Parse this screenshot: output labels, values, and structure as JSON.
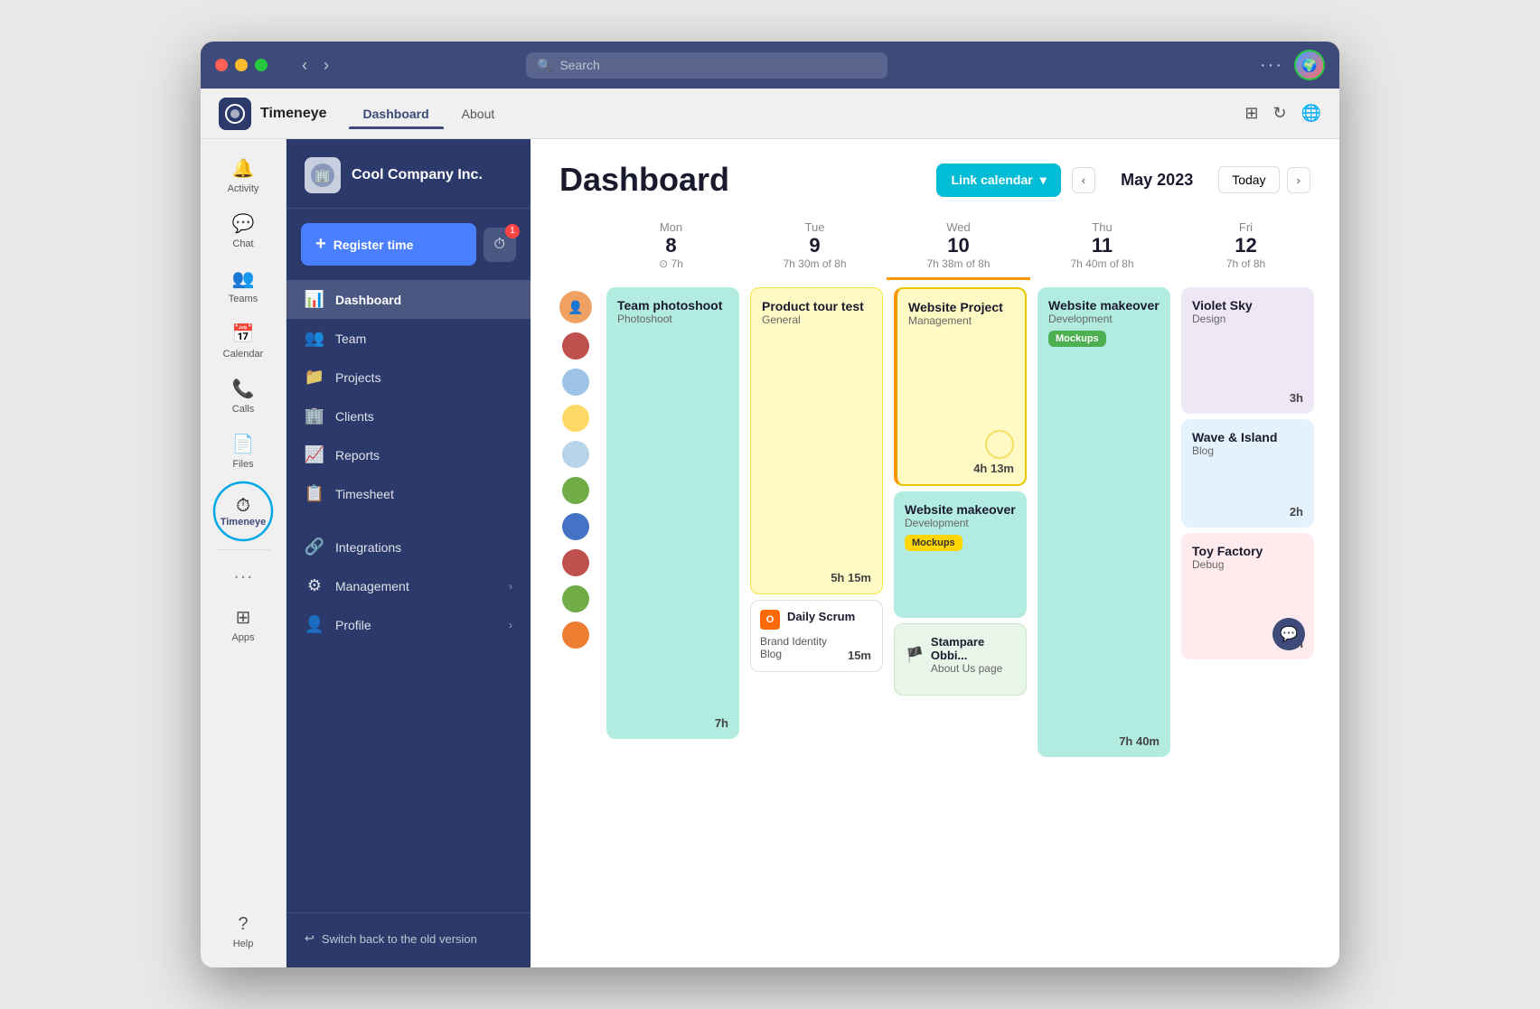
{
  "window": {
    "title": "Timeneye"
  },
  "titlebar": {
    "search_placeholder": "Search",
    "dots": "···"
  },
  "appbar": {
    "app_name": "Timeneye",
    "tabs": [
      {
        "label": "Dashboard",
        "active": true
      },
      {
        "label": "About",
        "active": false
      }
    ]
  },
  "teams_sidebar": {
    "items": [
      {
        "label": "Activity",
        "icon": "🔔"
      },
      {
        "label": "Chat",
        "icon": "💬"
      },
      {
        "label": "Teams",
        "icon": "👥"
      },
      {
        "label": "Calendar",
        "icon": "📅"
      },
      {
        "label": "Calls",
        "icon": "📞"
      },
      {
        "label": "Files",
        "icon": "📄"
      },
      {
        "label": "Timeneye",
        "icon": "⏱",
        "active": true,
        "circled": true
      },
      {
        "label": "Apps",
        "icon": "⊞"
      },
      {
        "label": "Help",
        "icon": "?"
      }
    ]
  },
  "sidebar": {
    "company": "Cool Company Inc.",
    "register_btn": "Register time",
    "timer_badge": "1",
    "nav_items": [
      {
        "label": "Dashboard",
        "icon": "📊",
        "active": true
      },
      {
        "label": "Team",
        "icon": "👥",
        "active": false
      },
      {
        "label": "Projects",
        "icon": "📁",
        "active": false
      },
      {
        "label": "Clients",
        "icon": "🏢",
        "active": false
      },
      {
        "label": "Reports",
        "icon": "📈",
        "active": false
      },
      {
        "label": "Timesheet",
        "icon": "📋",
        "active": false
      },
      {
        "label": "Integrations",
        "icon": "🔗",
        "active": false
      },
      {
        "label": "Management",
        "icon": "⚙",
        "active": false,
        "arrow": true
      },
      {
        "label": "Profile",
        "icon": "👤",
        "active": false,
        "arrow": true
      }
    ],
    "switch_version": "Switch back to the old version"
  },
  "content": {
    "title": "Dashboard",
    "link_calendar_btn": "Link calendar",
    "month": "May 2023",
    "today_btn": "Today",
    "days": [
      {
        "name": "Mon",
        "num": "8",
        "sub": "⊙ 7h"
      },
      {
        "name": "Tue",
        "num": "9",
        "sub": "7h 30m of 8h"
      },
      {
        "name": "Wed",
        "num": "10",
        "sub": "7h 38m of 8h",
        "today": true
      },
      {
        "name": "Thu",
        "num": "11",
        "sub": "7h 40m of 8h"
      },
      {
        "name": "Fri",
        "num": "12",
        "sub": "7h of 8h"
      }
    ],
    "events": {
      "mon": [
        {
          "title": "Team photoshoot",
          "sub": "Photoshoot",
          "color": "teal",
          "time": "7h"
        }
      ],
      "tue": [
        {
          "title": "Product tour test",
          "sub": "General",
          "color": "yellow",
          "time": "5h 15m"
        },
        {
          "title": "Daily Scrum",
          "sub": "Brand Identity\nBlog",
          "color": "white-bordered",
          "time": "15m",
          "icon": "O"
        }
      ],
      "wed": [
        {
          "title": "Website Project",
          "sub": "Management",
          "color": "yellow-accent",
          "time": "4h 13m"
        },
        {
          "title": "Website makeover",
          "sub": "Development",
          "tag": "Mockups",
          "color": "teal",
          "time": ""
        },
        {
          "title": "Stampare Obbi...",
          "sub": "About Us page",
          "color": "green-light",
          "icon": "flag"
        }
      ],
      "thu": [
        {
          "title": "Website makeover",
          "sub": "Development",
          "tag": "Mockups",
          "color": "teal",
          "time": "7h 40m"
        }
      ],
      "fri": [
        {
          "title": "Violet Sky",
          "sub": "Design",
          "color": "purple-light",
          "time": "3h"
        },
        {
          "title": "Wave & Island",
          "sub": "Blog",
          "color": "blue-light",
          "time": "2h"
        },
        {
          "title": "Toy Factory",
          "sub": "Debug",
          "color": "red-light",
          "time": "2h"
        }
      ]
    }
  },
  "avatars": [
    {
      "color": "#f0a060"
    },
    {
      "color": "#c0504d"
    },
    {
      "color": "#9dc3e6"
    },
    {
      "color": "#ffd966"
    },
    {
      "color": "#9dc3e6"
    },
    {
      "color": "#70ad47"
    },
    {
      "color": "#4472c4"
    },
    {
      "color": "#c0504d"
    },
    {
      "color": "#70ad47"
    },
    {
      "color": "#ed7d31"
    }
  ]
}
